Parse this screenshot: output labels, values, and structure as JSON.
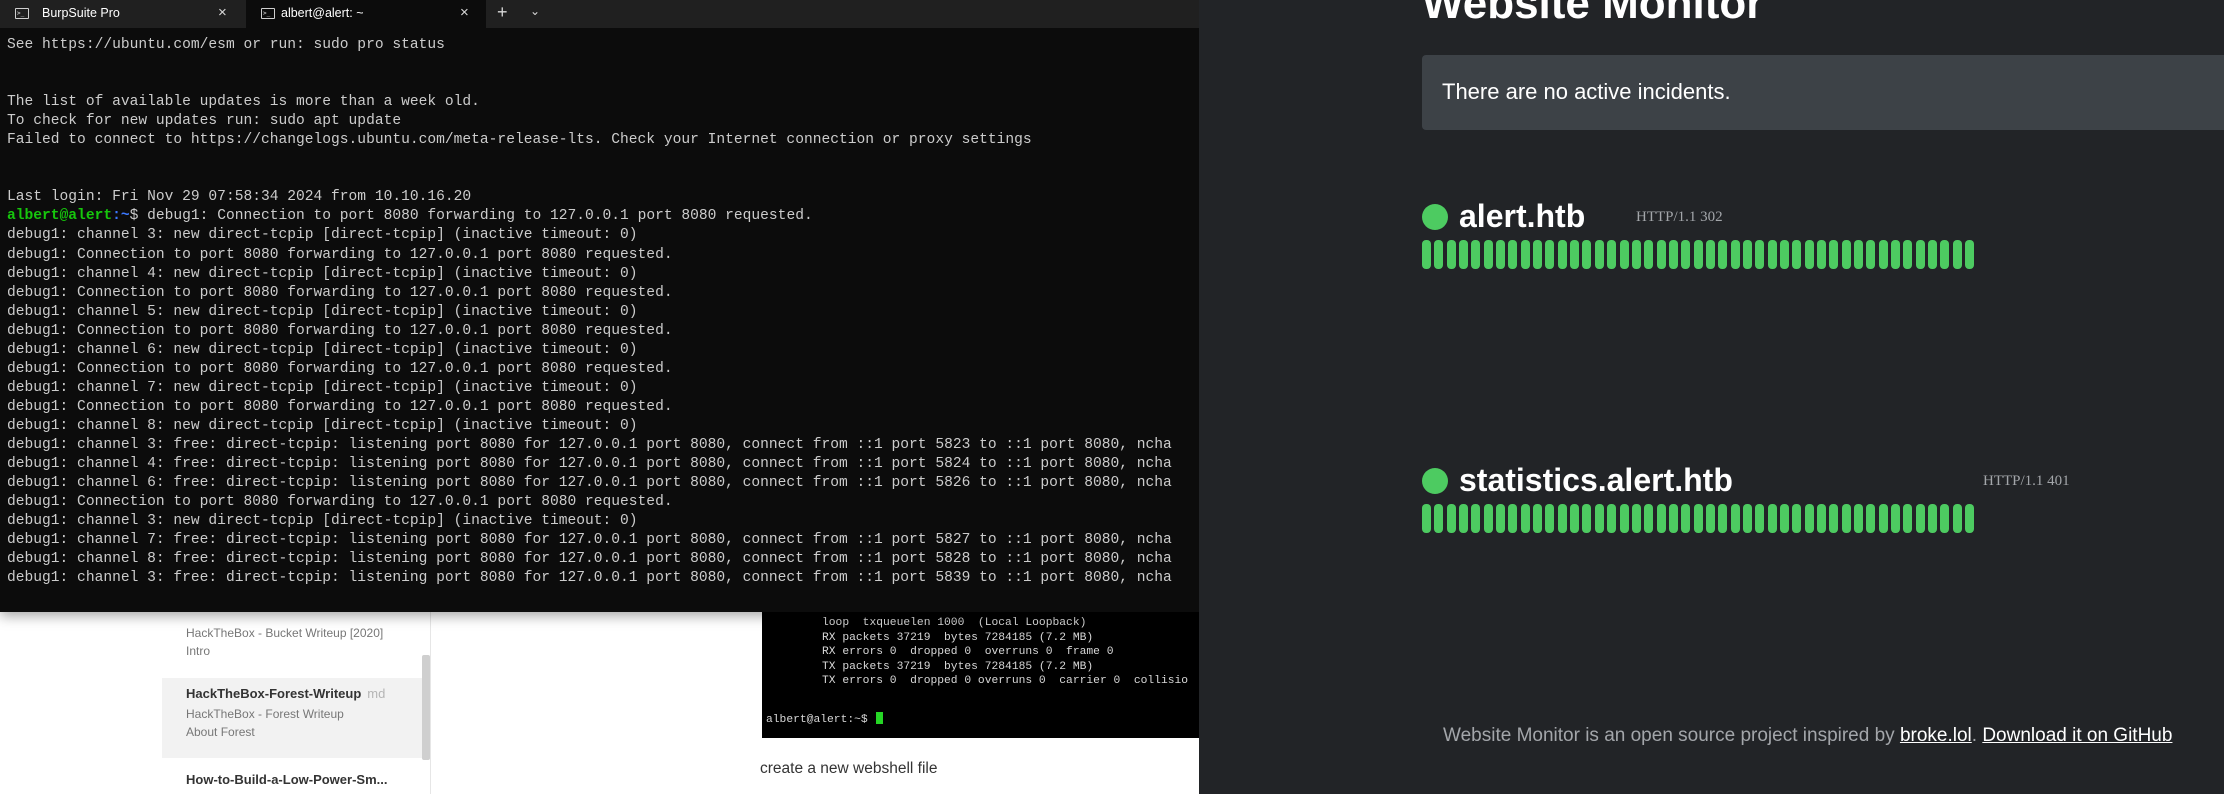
{
  "terminal": {
    "tabs": [
      {
        "label": "BurpSuite Pro",
        "icon": "terminal-icon",
        "active": false
      },
      {
        "label": "albert@alert: ~",
        "icon": "terminal-icon",
        "active": true
      }
    ],
    "new_tab_label": "+",
    "dropdown_label": "⌄",
    "close_label": "×",
    "prompt_user": "albert@alert",
    "prompt_path": ":~",
    "prompt_symbol": "$",
    "first_prompt_rest": " debug1: Connection to port 8080 forwarding to 127.0.0.1 port 8080 requested.",
    "lines_before_prompt": [
      "See https://ubuntu.com/esm or run: sudo pro status",
      "",
      "",
      "The list of available updates is more than a week old.",
      "To check for new updates run: sudo apt update",
      "Failed to connect to https://changelogs.ubuntu.com/meta-release-lts. Check your Internet connection or proxy settings",
      "",
      "",
      "Last login: Fri Nov 29 07:58:34 2024 from 10.10.16.20"
    ],
    "lines_after_prompt": [
      "debug1: channel 3: new direct-tcpip [direct-tcpip] (inactive timeout: 0)",
      "debug1: Connection to port 8080 forwarding to 127.0.0.1 port 8080 requested.",
      "debug1: channel 4: new direct-tcpip [direct-tcpip] (inactive timeout: 0)",
      "debug1: Connection to port 8080 forwarding to 127.0.0.1 port 8080 requested.",
      "debug1: channel 5: new direct-tcpip [direct-tcpip] (inactive timeout: 0)",
      "debug1: Connection to port 8080 forwarding to 127.0.0.1 port 8080 requested.",
      "debug1: channel 6: new direct-tcpip [direct-tcpip] (inactive timeout: 0)",
      "debug1: Connection to port 8080 forwarding to 127.0.0.1 port 8080 requested.",
      "debug1: channel 7: new direct-tcpip [direct-tcpip] (inactive timeout: 0)",
      "debug1: Connection to port 8080 forwarding to 127.0.0.1 port 8080 requested.",
      "debug1: channel 8: new direct-tcpip [direct-tcpip] (inactive timeout: 0)",
      "debug1: channel 3: free: direct-tcpip: listening port 8080 for 127.0.0.1 port 8080, connect from ::1 port 5823 to ::1 port 8080, ncha",
      "debug1: channel 4: free: direct-tcpip: listening port 8080 for 127.0.0.1 port 8080, connect from ::1 port 5824 to ::1 port 8080, ncha",
      "debug1: channel 6: free: direct-tcpip: listening port 8080 for 127.0.0.1 port 8080, connect from ::1 port 5826 to ::1 port 8080, ncha",
      "debug1: Connection to port 8080 forwarding to 127.0.0.1 port 8080 requested.",
      "debug1: channel 3: new direct-tcpip [direct-tcpip] (inactive timeout: 0)",
      "debug1: channel 7: free: direct-tcpip: listening port 8080 for 127.0.0.1 port 8080, connect from ::1 port 5827 to ::1 port 8080, ncha",
      "debug1: channel 8: free: direct-tcpip: listening port 8080 for 127.0.0.1 port 8080, connect from ::1 port 5828 to ::1 port 8080, ncha",
      "debug1: channel 3: free: direct-tcpip: listening port 8080 for 127.0.0.1 port 8080, connect from ::1 port 5839 to ::1 port 8080, ncha"
    ]
  },
  "notes_app": {
    "entries": [
      {
        "title": "",
        "ext": "",
        "subtitle": "HackTheBox - Bucket Writeup [2020]",
        "subtitle2": "Intro",
        "active": false
      },
      {
        "title": "HackTheBox-Forest-Writeup",
        "ext": "md",
        "subtitle": "HackTheBox - Forest Writeup",
        "subtitle2": "About Forest",
        "active": true
      },
      {
        "title": "How-to-Build-a-Low-Power-Sm...",
        "ext": "",
        "subtitle": "",
        "subtitle2": "",
        "active": false
      }
    ],
    "embedded_terminal_lines": [
      "loop  txqueuelen 1000  (Local Loopback)",
      "RX packets 37219  bytes 7284185 (7.2 MB)",
      "RX errors 0  dropped 0  overruns 0  frame 0",
      "TX packets 37219  bytes 7284185 (7.2 MB)",
      "TX errors 0  dropped 0 overruns 0  carrier 0  collisio"
    ],
    "embedded_prompt": "albert@alert:~$",
    "caption": "create a new webshell file"
  },
  "monitor": {
    "title": "Website Monitor",
    "incident_text": "There are no active incidents.",
    "accent_color": "#4dcb61",
    "sites": [
      {
        "name": "alert.htb",
        "status": "HTTP/1.1 302",
        "uptime_checks": 45
      },
      {
        "name": "statistics.alert.htb",
        "status": "HTTP/1.1 401",
        "uptime_checks": 45
      }
    ],
    "footer_text": "Website Monitor is an open source project inspired by ",
    "footer_link1": "broke.lol",
    "footer_sep": ". ",
    "footer_link2": "Download it on GitHub"
  }
}
